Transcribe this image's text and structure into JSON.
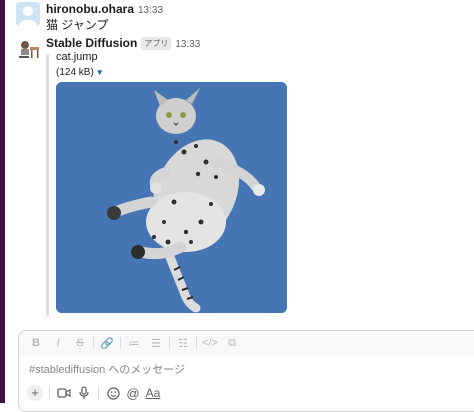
{
  "messages": [
    {
      "user": "hironobu.ohara",
      "time": "13:33",
      "text": "猫 ジャンプ"
    },
    {
      "user": "Stable Diffusion",
      "badge": "アプリ",
      "time": "13:33",
      "attachment": {
        "filename": "cat.jump",
        "size": "(124 kB)",
        "image_description_icon": "cat-jumping-image"
      }
    }
  ],
  "composer": {
    "placeholder": "#stablediffusion へのメッセージ",
    "format_buttons": [
      "B",
      "I",
      "S",
      "🔗",
      "≔",
      "☰",
      "☷",
      "</>",
      "⧉"
    ],
    "bottom_buttons": {
      "font_label": "Aa"
    }
  },
  "colors": {
    "sidebar": "#3f0e40",
    "image_bg": "#4675b3"
  }
}
